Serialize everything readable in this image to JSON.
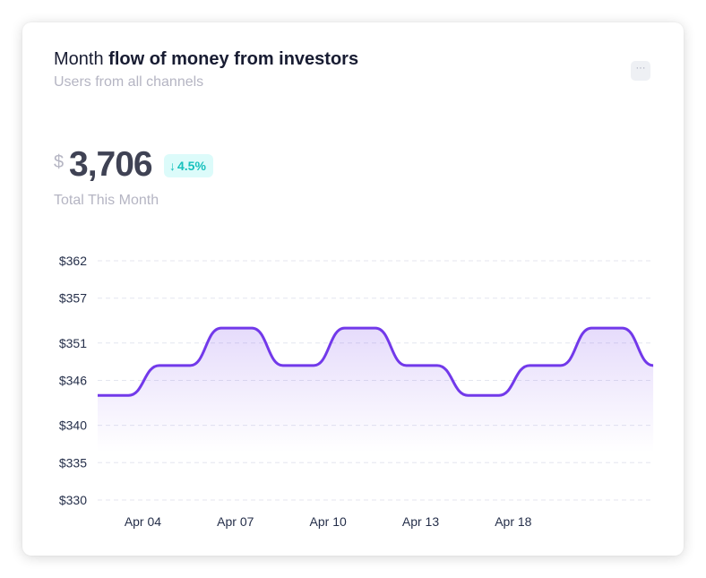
{
  "header": {
    "title_prefix": "Month",
    "title_bold": "flow of money from investors",
    "subtitle": "Users from all channels",
    "menu_label": "···"
  },
  "summary": {
    "currency": "$",
    "amount": "3,706",
    "change": "4.5%",
    "change_direction": "down",
    "arrow": "↓",
    "label": "Total This Month"
  },
  "colors": {
    "line": "#7239ea",
    "fill": "#7239ea",
    "badge_bg": "#dcfbfa",
    "badge_text": "#17c1bd"
  },
  "chart_data": {
    "type": "area",
    "ylim": [
      330,
      362
    ],
    "yticks": [
      {
        "value": 362,
        "label": "$362"
      },
      {
        "value": 357,
        "label": "$357"
      },
      {
        "value": 351,
        "label": "$351"
      },
      {
        "value": 346,
        "label": "$346"
      },
      {
        "value": 340,
        "label": "$340"
      },
      {
        "value": 335,
        "label": "$335"
      },
      {
        "value": 330,
        "label": "$330"
      }
    ],
    "xticks": [
      {
        "index": 1,
        "label": "Apr 04"
      },
      {
        "index": 4,
        "label": "Apr 07"
      },
      {
        "index": 7,
        "label": "Apr 10"
      },
      {
        "index": 10,
        "label": "Apr 13"
      },
      {
        "index": 13,
        "label": "Apr 18"
      }
    ],
    "values": [
      344,
      344,
      348,
      348,
      353,
      353,
      348,
      348,
      353,
      353,
      348,
      348,
      344,
      344,
      348,
      348,
      353,
      353,
      348
    ],
    "grid": true,
    "legend": "none"
  }
}
